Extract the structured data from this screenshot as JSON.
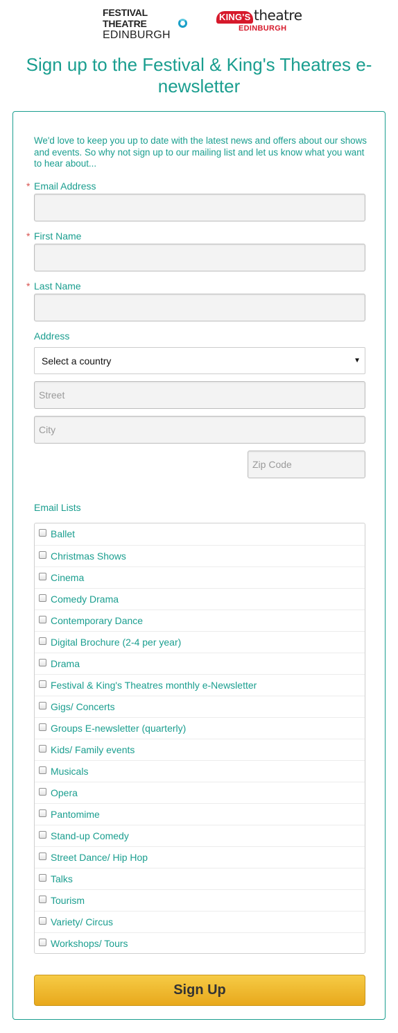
{
  "logos": {
    "festival_line1": "FESTIVAL THEATRE",
    "festival_line2": "EDINBURGH",
    "kings_badge": "KING'S",
    "kings_word": "theatre",
    "kings_city": "EDINBURGH"
  },
  "title": "Sign up to the Festival & King's Theatres e-newsletter",
  "intro": "We'd love to keep you up to date with the latest news and offers about our shows and events. So why not sign up to our mailing list and let us know what you want to hear about...",
  "form": {
    "required_marker": "*",
    "email_label": "Email Address",
    "email_value": "",
    "first_name_label": "First Name",
    "first_name_value": "",
    "last_name_label": "Last Name",
    "last_name_value": "",
    "address_label": "Address",
    "country_select": "Select a country",
    "street_placeholder": "Street",
    "city_placeholder": "City",
    "zip_placeholder": "Zip Code",
    "email_lists_label": "Email Lists",
    "submit_label": "Sign Up"
  },
  "email_lists": [
    {
      "label": "Ballet",
      "checked": false
    },
    {
      "label": "Christmas Shows",
      "checked": false
    },
    {
      "label": "Cinema",
      "checked": false
    },
    {
      "label": "Comedy Drama",
      "checked": false
    },
    {
      "label": "Contemporary Dance",
      "checked": false
    },
    {
      "label": "Digital Brochure (2-4 per year)",
      "checked": false
    },
    {
      "label": "Drama",
      "checked": false
    },
    {
      "label": "Festival & King's Theatres monthly e-Newsletter",
      "checked": false
    },
    {
      "label": "Gigs/ Concerts",
      "checked": false
    },
    {
      "label": "Groups E-newsletter (quarterly)",
      "checked": false
    },
    {
      "label": "Kids/ Family events",
      "checked": false
    },
    {
      "label": "Musicals",
      "checked": false
    },
    {
      "label": "Opera",
      "checked": false
    },
    {
      "label": "Pantomime",
      "checked": false
    },
    {
      "label": "Stand-up Comedy",
      "checked": false
    },
    {
      "label": "Street Dance/ Hip Hop",
      "checked": false
    },
    {
      "label": "Talks",
      "checked": false
    },
    {
      "label": "Tourism",
      "checked": false
    },
    {
      "label": "Variety/ Circus",
      "checked": false
    },
    {
      "label": "Workshops/ Tours",
      "checked": false
    }
  ],
  "colors": {
    "accent": "#1a9e8f",
    "required": "#d9534f",
    "button": "#eab024",
    "kings_red": "#d6192b"
  }
}
